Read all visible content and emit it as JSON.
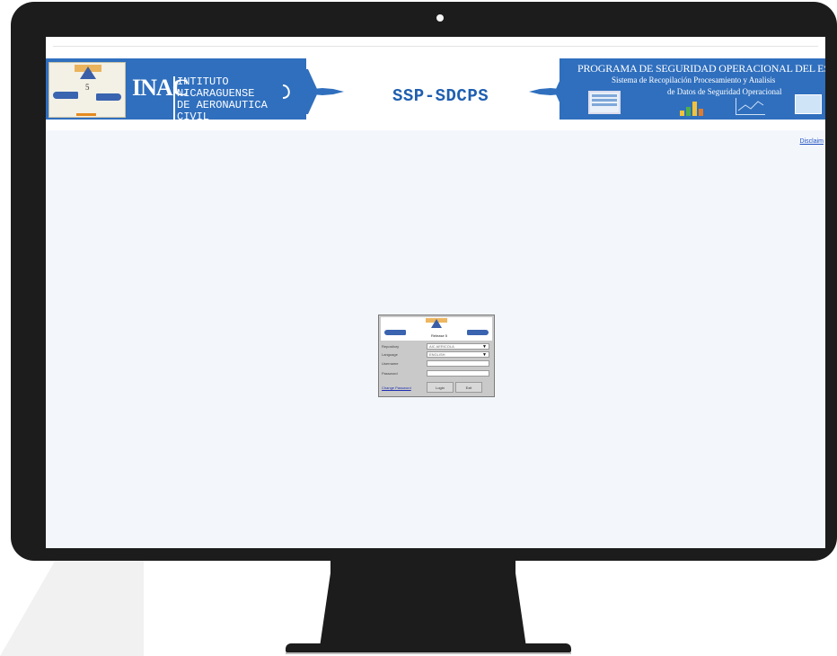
{
  "banner": {
    "left_acronym": "INAC",
    "left_name_line1": "INTITUTO NICARAGUENSE",
    "left_name_line2": "DE AERONAUTICA CIVIL",
    "center_title": "SSP-SDCPS",
    "right_title": "PROGRAMA DE SEGURIDAD OPERACIONAL DEL ESTADO",
    "right_sub1": "Sistema de Recopilación Procesamiento y Analisis",
    "right_sub2": "de Datos de Seguridad Operacional",
    "logo_number": "5",
    "accent_color": "#2f6fbe"
  },
  "disclaimer_link": "Disclaim",
  "login": {
    "release": "Release 5",
    "fields": [
      {
        "label": "Repository",
        "value": "AIC AERICOLA"
      },
      {
        "label": "Language",
        "value": "ENGLISH"
      },
      {
        "label": "Username",
        "value": ""
      },
      {
        "label": "Password",
        "value": ""
      }
    ],
    "change_password": "Change Password",
    "login_button": "Login",
    "exit_button": "Exit"
  }
}
